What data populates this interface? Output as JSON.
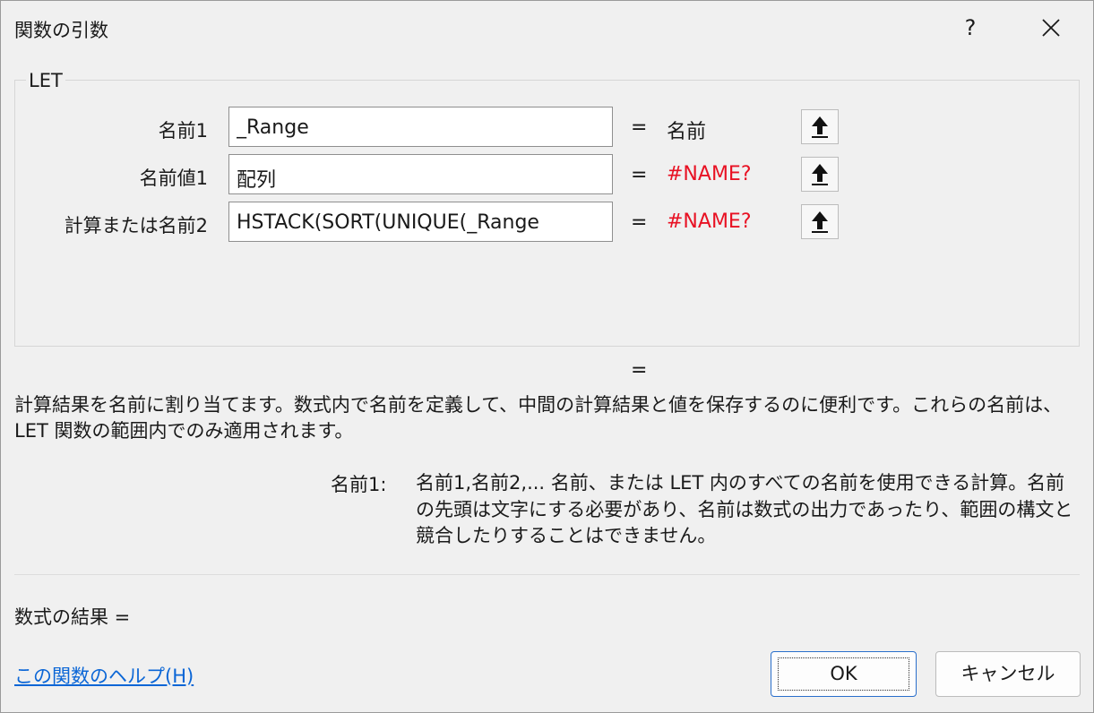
{
  "window": {
    "title": "関数の引数",
    "help_label": "?"
  },
  "group": {
    "function_name": "LET"
  },
  "args": [
    {
      "label": "名前1",
      "value": "_Range",
      "result": "名前",
      "result_color": "#1a1a1a"
    },
    {
      "label": "名前値1",
      "value": "配列",
      "result": "#NAME?",
      "result_color": "#e81123"
    },
    {
      "label": "計算または名前2",
      "value": "HSTACK(SORT(UNIQUE(_Range",
      "result": "#NAME?",
      "result_color": "#e81123"
    }
  ],
  "equals": "=",
  "description": {
    "line1": "計算結果を名前に割り当てます。数式内で名前を定義して、中間の計算結果と値を保存するのに便利です。これらの名前は、",
    "line2": "LET 関数の範囲内でのみ適用されます。"
  },
  "arg_help": {
    "name": "名前1:",
    "text": "名前1,名前2,... 名前、または LET 内のすべての名前を使用できる計算。名前の先頭は文字にする必要があり、名前は数式の出力であったり、範囲の構文と競合したりすることはできません。"
  },
  "formula_result": "数式の結果 =",
  "help_link": "この関数のヘルプ(H)",
  "buttons": {
    "ok": "OK",
    "cancel": "キャンセル"
  },
  "icons": {
    "ref": "up-arrow-icon",
    "close": "close-icon"
  },
  "colors": {
    "error": "#e81123",
    "link": "#0b66d6",
    "accent": "#2a6fcb"
  }
}
